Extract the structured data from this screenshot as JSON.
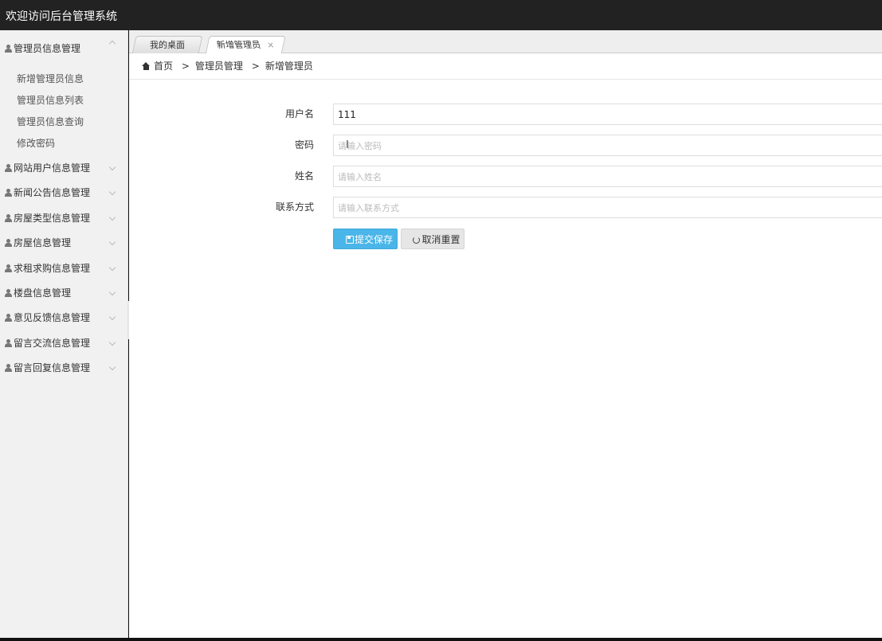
{
  "app": {
    "title": "欢迎访问后台管理系统"
  },
  "sidebar": {
    "groups": [
      {
        "label": "管理员信息管理",
        "expanded": true,
        "items": [
          "新增管理员信息",
          "管理员信息列表",
          "管理员信息查询",
          "修改密码"
        ]
      },
      {
        "label": "网站用户信息管理"
      },
      {
        "label": "新闻公告信息管理"
      },
      {
        "label": "房屋类型信息管理"
      },
      {
        "label": "房屋信息管理"
      },
      {
        "label": "求租求购信息管理"
      },
      {
        "label": "楼盘信息管理"
      },
      {
        "label": "意见反馈信息管理"
      },
      {
        "label": "留言交流信息管理"
      },
      {
        "label": "留言回复信息管理"
      }
    ]
  },
  "tabs": [
    {
      "label": "我的桌面"
    },
    {
      "label": "新增管理员",
      "close": "×"
    }
  ],
  "breadcrumb": {
    "home": "首页",
    "sep": ">",
    "level1": "管理员管理",
    "level2": "新增管理员"
  },
  "form": {
    "username": {
      "label": "用户名",
      "value": "111"
    },
    "password": {
      "label": "密码",
      "placeholder": "请输入密码"
    },
    "name": {
      "label": "姓名",
      "placeholder": "请输入姓名"
    },
    "contact": {
      "label": "联系方式",
      "placeholder": "请输入联系方式"
    },
    "submit_label": "提交保存",
    "reset_label": "取消重置"
  },
  "icons": {
    "user": "user-icon",
    "home": "home-icon",
    "save": "save-icon",
    "refresh": "refresh-icon",
    "collapse": "caret-left-icon"
  },
  "colors": {
    "topbar": "#222222",
    "primary": "#4ab5e8",
    "sidebar": "#f1f1f1"
  }
}
